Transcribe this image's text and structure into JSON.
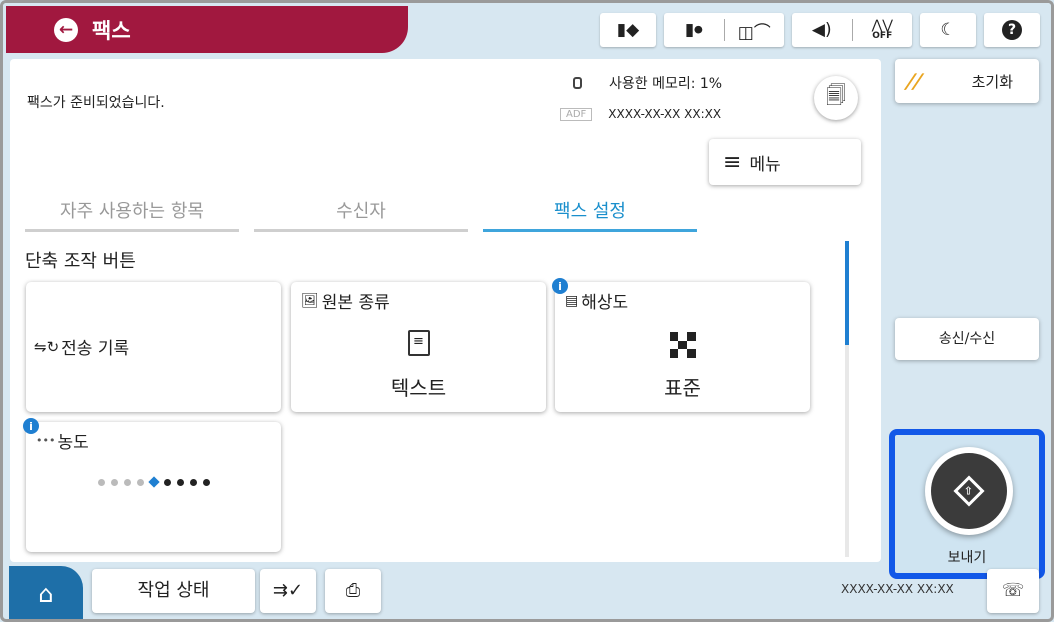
{
  "header": {
    "title": "팩스",
    "icons": {
      "ink": "ink-cartridge-icon",
      "maintenance": "maintenance-box-icon",
      "wifi": "wifi-icon",
      "sound": "sound-icon",
      "fax_off": "OFF",
      "sleep": "sleep-moon-icon",
      "help": "?"
    }
  },
  "main": {
    "status_message": "팩스가 준비되었습니다.",
    "memory_label": "사용한 메모리: 1%",
    "adf_tag": "ADF",
    "adf_datetime": "XXXX-XX-XX XX:XX",
    "menu_label": "메뉴",
    "tabs": [
      {
        "label": "자주 사용하는 항목",
        "active": false
      },
      {
        "label": "수신자",
        "active": false
      },
      {
        "label": "팩스 설정",
        "active": true
      }
    ],
    "section_label": "단축 조작 버튼",
    "tiles": {
      "history": {
        "label": "전송 기록"
      },
      "original_type": {
        "label": "원본 종류",
        "value": "텍스트"
      },
      "resolution": {
        "label": "해상도",
        "value": "표준"
      },
      "density": {
        "label": "농도",
        "level": 5,
        "steps": 9
      }
    }
  },
  "right": {
    "reset_label": "초기화",
    "sendrecv_label": "송신/수신",
    "send_label": "보내기"
  },
  "bottom": {
    "job_status_label": "작업 상태",
    "datetime": "XXXX-XX-XX XX:XX"
  },
  "colors": {
    "accent_red": "#a1183f",
    "accent_blue": "#1f7fd1",
    "send_border": "#1258e8",
    "background": "#d7e7f1"
  }
}
